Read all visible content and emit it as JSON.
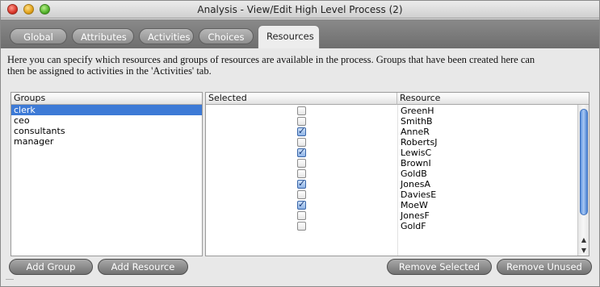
{
  "window": {
    "title": "Analysis - View/Edit High Level Process (2)"
  },
  "tabs": [
    {
      "label": "Global"
    },
    {
      "label": "Attributes"
    },
    {
      "label": "Activities"
    },
    {
      "label": "Choices"
    },
    {
      "label": "Resources",
      "active": true
    }
  ],
  "description": {
    "line1": "Here you can specify which resources and groups of resources are available in the process. Groups that have been created here can",
    "line2": "then be assigned to activities in the 'Activities' tab."
  },
  "groups_table": {
    "header": "Groups",
    "selected_index": 0,
    "rows": [
      {
        "label": "clerk"
      },
      {
        "label": "ceo"
      },
      {
        "label": "consultants"
      },
      {
        "label": "manager"
      }
    ]
  },
  "resources_table": {
    "header_selected": "Selected",
    "header_resource": "Resource",
    "rows": [
      {
        "name": "GreenH",
        "selected": false
      },
      {
        "name": "SmithB",
        "selected": false
      },
      {
        "name": "AnneR",
        "selected": true
      },
      {
        "name": "RobertsJ",
        "selected": false
      },
      {
        "name": "LewisC",
        "selected": true
      },
      {
        "name": "BrownI",
        "selected": false
      },
      {
        "name": "GoldB",
        "selected": false
      },
      {
        "name": "JonesA",
        "selected": true
      },
      {
        "name": "DaviesE",
        "selected": false
      },
      {
        "name": "MoeW",
        "selected": true
      },
      {
        "name": "JonesF",
        "selected": false
      },
      {
        "name": "GoldF",
        "selected": false
      }
    ]
  },
  "buttons": {
    "add_group": "Add Group",
    "add_resource": "Add Resource",
    "remove_selected": "Remove Selected",
    "remove_unused": "Remove Unused"
  },
  "icons": {
    "close": "close-window-icon",
    "minimize": "minimize-window-icon",
    "maximize": "maximize-window-icon",
    "check": "checkmark-icon",
    "scroll_up": "scroll-up-arrow-icon",
    "scroll_down": "scroll-down-arrow-icon"
  },
  "colors": {
    "selection": "#3d7ad6",
    "checkbox_checked": "#8fb4e6"
  }
}
